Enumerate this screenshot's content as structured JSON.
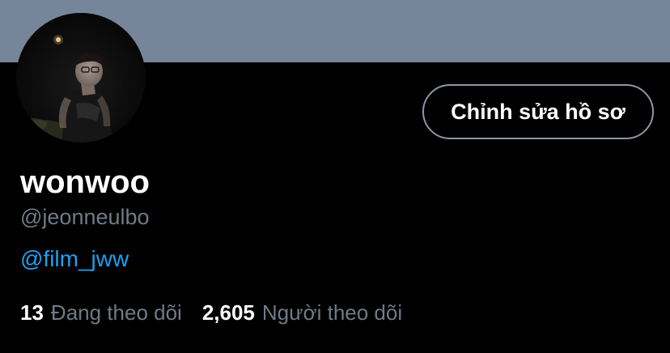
{
  "colors": {
    "background": "#000000",
    "banner": "#76859A",
    "text_primary": "#FFFFFF",
    "text_secondary": "#6E7B86",
    "link": "#1DA1F2",
    "button_border": "#8899A6"
  },
  "profile": {
    "avatar_icon": "profile-photo",
    "edit_button_label": "Chỉnh sửa hồ sơ",
    "display_name": "wonwoo",
    "handle": "@jeonneulbo",
    "bio_link": "@film_jww"
  },
  "stats": {
    "following_count": "13",
    "following_label": "Đang theo dõi",
    "followers_count": "2,605",
    "followers_label": "Người theo dõi"
  }
}
